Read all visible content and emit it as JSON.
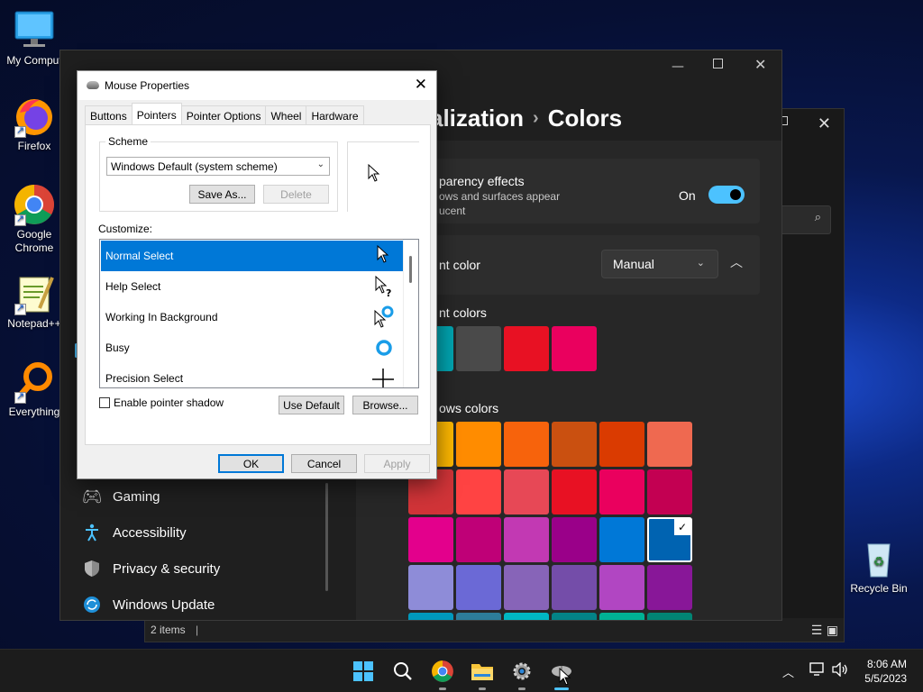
{
  "desktop": {
    "icons": [
      {
        "label": "My Comput",
        "icon": "monitor-icon"
      },
      {
        "label": "Firefox",
        "icon": "firefox-icon"
      },
      {
        "label": "Google Chrome",
        "icon": "chrome-icon"
      },
      {
        "label": "Notepad++",
        "icon": "notepadpp-icon"
      },
      {
        "label": "Everything",
        "icon": "everything-icon"
      },
      {
        "label": "Recycle Bin",
        "icon": "recycle-bin-icon"
      }
    ]
  },
  "explorer": {
    "status_text": "2 items"
  },
  "settings": {
    "breadcrumb_parent": "alization",
    "breadcrumb_current": "Colors",
    "nav_items": [
      {
        "label": "Gaming",
        "icon": "gamepad-icon"
      },
      {
        "label": "Accessibility",
        "icon": "accessibility-icon"
      },
      {
        "label": "Privacy & security",
        "icon": "shield-icon"
      },
      {
        "label": "Windows Update",
        "icon": "update-icon"
      }
    ],
    "transparency_title": "parency effects",
    "transparency_desc_1": "ows and surfaces appear",
    "transparency_desc_2": "ucent",
    "transparency_state": "On",
    "accent_label": "nt color",
    "accent_mode": "Manual",
    "recent_colors_label": "nt colors",
    "windows_colors_label": "ows colors",
    "recent_colors": [
      "#00a5b1",
      "#4a4a4a",
      "#e81123",
      "#ea005e"
    ],
    "windows_colors": [
      [
        "#ffb900",
        "#ff8c00",
        "#f7630c",
        "#ca5010",
        "#da3b01",
        "#ef6950"
      ],
      [
        "#d13438",
        "#ff4343",
        "#e74856",
        "#e81123",
        "#ea005e",
        "#c30052"
      ],
      [
        "#e3008c",
        "#bf0077",
        "#c239b3",
        "#9a0089",
        "#0078d7",
        "#0063b1"
      ],
      [
        "#8e8cd8",
        "#6b69d6",
        "#8764b8",
        "#744da9",
        "#b146c2",
        "#881798"
      ],
      [
        "#0099bc",
        "#2d7d9a",
        "#00b7c3",
        "#038387",
        "#00b294",
        "#018574"
      ]
    ],
    "selected_color": "#0063b1"
  },
  "dialog": {
    "title": "Mouse Properties",
    "tabs": [
      "Buttons",
      "Pointers",
      "Pointer Options",
      "Wheel",
      "Hardware"
    ],
    "active_tab": "Pointers",
    "scheme_label": "Scheme",
    "scheme_value": "Windows Default (system scheme)",
    "save_as_label": "Save As...",
    "delete_label": "Delete",
    "customize_label": "Customize:",
    "pointers": [
      {
        "label": "Normal Select",
        "cursor": "arrow-cursor-icon"
      },
      {
        "label": "Help Select",
        "cursor": "help-cursor-icon"
      },
      {
        "label": "Working In Background",
        "cursor": "working-cursor-icon"
      },
      {
        "label": "Busy",
        "cursor": "busy-cursor-icon"
      },
      {
        "label": "Precision Select",
        "cursor": "crosshair-cursor-icon"
      }
    ],
    "selected_pointer": "Normal Select",
    "shadow_label": "Enable pointer shadow",
    "use_default_label": "Use Default",
    "browse_label": "Browse...",
    "ok_label": "OK",
    "cancel_label": "Cancel",
    "apply_label": "Apply"
  },
  "taskbar": {
    "time": "8:06 AM",
    "date": "5/5/2023"
  },
  "colors": {
    "accent": "#0078d7",
    "toggle_on": "#4cc2ff"
  }
}
